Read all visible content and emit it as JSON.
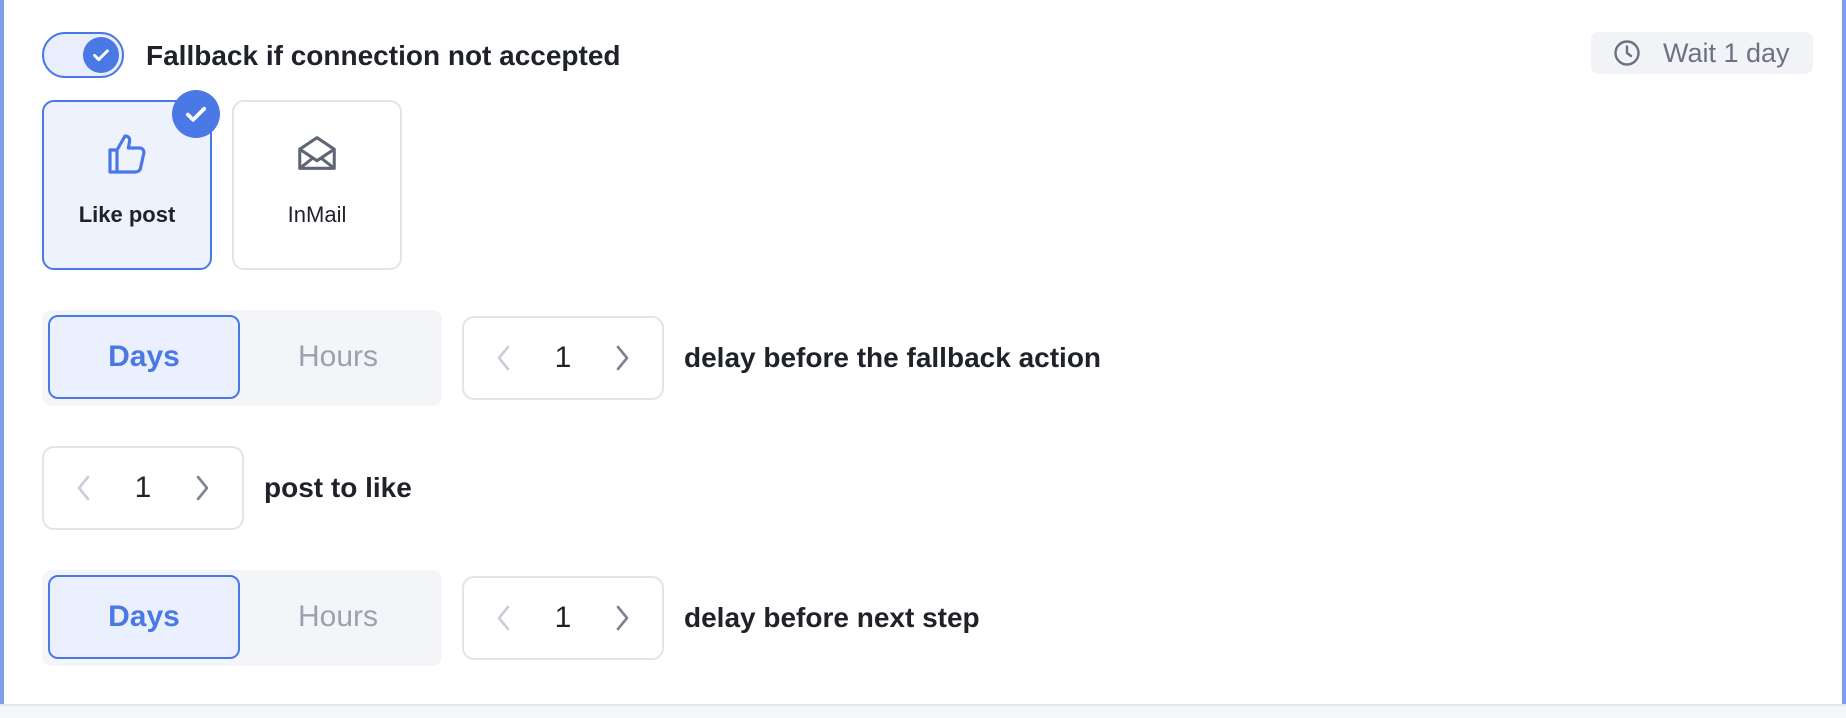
{
  "fallback": {
    "toggle_on": true,
    "label": "Fallback if connection not accepted"
  },
  "wait_badge": {
    "icon": "clock-icon",
    "text": "Wait 1 day"
  },
  "actions": [
    {
      "label": "Like post",
      "icon": "thumbs-up-icon",
      "selected": true
    },
    {
      "label": "InMail",
      "icon": "open-envelope-icon",
      "selected": false
    }
  ],
  "fallback_delay": {
    "units": [
      "Days",
      "Hours"
    ],
    "selected_unit": "Days",
    "value": "1",
    "label": "delay before the fallback action"
  },
  "posts": {
    "value": "1",
    "label": "post to like"
  },
  "next_step_delay": {
    "units": [
      "Days",
      "Hours"
    ],
    "selected_unit": "Days",
    "value": "1",
    "label": "delay before next step"
  },
  "colors": {
    "accent": "#4a78e4",
    "accent_light": "#eaf0fd",
    "muted_text": "#9ba1ae",
    "border": "#e2e4ea"
  }
}
